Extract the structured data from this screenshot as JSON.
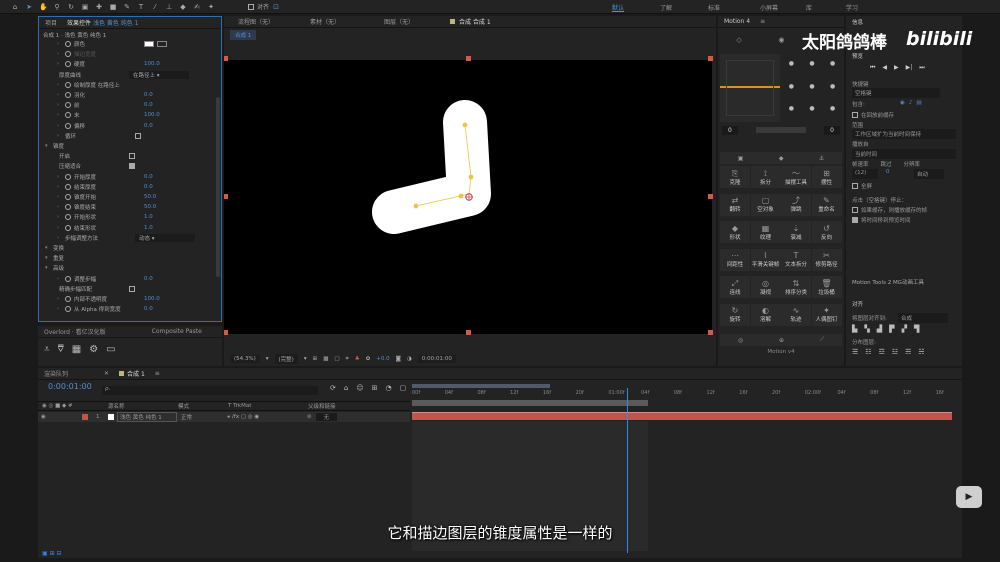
{
  "toolbar": {
    "snap_label": "对齐",
    "workspaces": [
      "默认",
      "了解",
      "标准",
      "小屏幕",
      "库",
      "学习"
    ],
    "active_workspace": "默认"
  },
  "effects_panel": {
    "tab_project": "项目",
    "tab_effects": "效果控件",
    "tab_effects_layer": "浅色 黄色 纯色 1",
    "breadcrumb": "合成 1 · 浅色 黄色 纯色 1",
    "rows": [
      {
        "label": "颜色",
        "value": "",
        "indent": 2,
        "kind": "color"
      },
      {
        "label": "描边宽度",
        "value": "",
        "indent": 2,
        "kind": "dim"
      },
      {
        "label": "硬度",
        "value": "100.0",
        "indent": 2,
        "kind": "value"
      },
      {
        "label": "厚度曲线",
        "value": "在路径上",
        "indent": 1,
        "kind": "dropdown"
      },
      {
        "label": "绘制厚度 在路径上",
        "value": "",
        "indent": 2,
        "kind": "text"
      },
      {
        "label": "羽化",
        "value": "0.0",
        "indent": 2,
        "kind": "value"
      },
      {
        "label": "前",
        "value": "0.0",
        "indent": 2,
        "kind": "value"
      },
      {
        "label": "末",
        "value": "100.0",
        "indent": 2,
        "kind": "value"
      },
      {
        "label": "偏移",
        "value": "0.0",
        "indent": 2,
        "kind": "value"
      },
      {
        "label": "循环",
        "value": "",
        "indent": 2,
        "kind": "checkbox"
      },
      {
        "label": "锥度",
        "value": "",
        "indent": 0,
        "kind": "group"
      },
      {
        "label": "开启",
        "value": "",
        "indent": 1,
        "kind": "checkbox"
      },
      {
        "label": "压缩适合",
        "value": "",
        "indent": 1,
        "kind": "checkbox-on"
      },
      {
        "label": "开始厚度",
        "value": "0.0",
        "indent": 2,
        "kind": "value"
      },
      {
        "label": "结束厚度",
        "value": "0.0",
        "indent": 2,
        "kind": "value"
      },
      {
        "label": "锥度开始",
        "value": "50.0",
        "indent": 2,
        "kind": "value"
      },
      {
        "label": "锥度结束",
        "value": "50.0",
        "indent": 2,
        "kind": "value"
      },
      {
        "label": "开始形状",
        "value": "1.0",
        "indent": 2,
        "kind": "value"
      },
      {
        "label": "结束形状",
        "value": "1.0",
        "indent": 2,
        "kind": "value"
      },
      {
        "label": "步幅调整方法",
        "value": "动态",
        "indent": 2,
        "kind": "dropdown"
      },
      {
        "label": "变换",
        "value": "",
        "indent": 0,
        "kind": "group"
      },
      {
        "label": "重复",
        "value": "",
        "indent": 0,
        "kind": "group"
      },
      {
        "label": "高级",
        "value": "",
        "indent": 0,
        "kind": "group"
      },
      {
        "label": "调整步幅",
        "value": "0.0",
        "indent": 2,
        "kind": "value"
      },
      {
        "label": "精确步幅匹配",
        "value": "",
        "indent": 1,
        "kind": "checkbox"
      },
      {
        "label": "内部不透明度",
        "value": "100.0",
        "indent": 2,
        "kind": "value"
      },
      {
        "label": "从 Alpha 得到宽度",
        "value": "0.0",
        "indent": 2,
        "kind": "value"
      }
    ]
  },
  "overlord_tab": "Overlord · 看亿汉化版",
  "composite_tab": "Composite Paste",
  "viewer": {
    "tabs": [
      "流程图（无）",
      "素材（无）",
      "图层（无）",
      "合成 合成 1"
    ],
    "active_tab": "合成 合成 1",
    "comp_chip": "合成 1",
    "zoom": "(54.3%)",
    "quality": "(完整)",
    "exposure": "+0.0",
    "timecode": "0:00:01:00"
  },
  "motion": {
    "title": "Motion 4",
    "field_left": "0",
    "field_right": "0",
    "buttons": [
      "克隆",
      "拆分",
      "描摆工具",
      "摆性",
      "翻转",
      "空对象",
      "弹跳",
      "重命名",
      "形状",
      "纹理",
      "衰减",
      "反向",
      "间距性",
      "平滑关键帧",
      "文本拆分",
      "修剪路径",
      "连线",
      "凝视",
      "排序分类",
      "垃圾桶",
      "旋转",
      "溶解",
      "轨迹",
      "人偶图钉"
    ],
    "footer": "Motion v4"
  },
  "info": {
    "title": "信息",
    "preview_title": "预览",
    "shortcut_label": "快捷键",
    "shortcut_value": "空格键",
    "include_label": "包含:",
    "cache_label": "在回放前缓存",
    "range_label": "范围",
    "range_value": "工作区域扩为当前时间保持",
    "play_from_label": "播放自",
    "play_from_value": "当前时间",
    "fps_label": "帧速率",
    "skip_label": "跳过",
    "res_label": "分辨率",
    "fps_value": "(12)",
    "skip_value": "0",
    "res_value": "自动",
    "fullscreen_label": "全屏",
    "stop_hint": "点击（空格键）停止：",
    "opt1": "如果缓存，则播放缓存的帧",
    "opt2": "将时间移到预览时间",
    "motion_tools": "Motion Tools 2 MG动画工具",
    "align_title": "对齐",
    "align_to_label": "将图层对齐到:",
    "align_to_value": "合成",
    "distribute_label": "分布图层:"
  },
  "timeline": {
    "tab_render": "渲染队列",
    "tab_comp": "合成 1",
    "timecode": "0:00:01:00",
    "search_placeholder": "ρ.",
    "col_src": "源名称",
    "col_mode": "模式",
    "col_trkmat": "T TrkMat",
    "col_parent": "父级和链接",
    "layer_num": "1",
    "layer_name": "浅色 黄色 纯色 1",
    "layer_mode": "正常",
    "layer_parent": "无",
    "ruler_ticks": [
      "00f",
      "04f",
      "08f",
      "12f",
      "16f",
      "20f",
      "01:00f",
      "04f",
      "08f",
      "12f",
      "16f",
      "20f",
      "02:00f",
      "04f",
      "08f",
      "12f",
      "16f"
    ],
    "playhead_fraction": 0.39
  },
  "watermark": {
    "author": "太阳鸽鸽棒",
    "logo": "bilibili"
  },
  "subtitle": "它和描边图层的锥度属性是一样的",
  "colors": {
    "accent_blue": "#2d8ceb",
    "layer_red": "#c25450",
    "stroke_yellow": "#e9c64a"
  }
}
